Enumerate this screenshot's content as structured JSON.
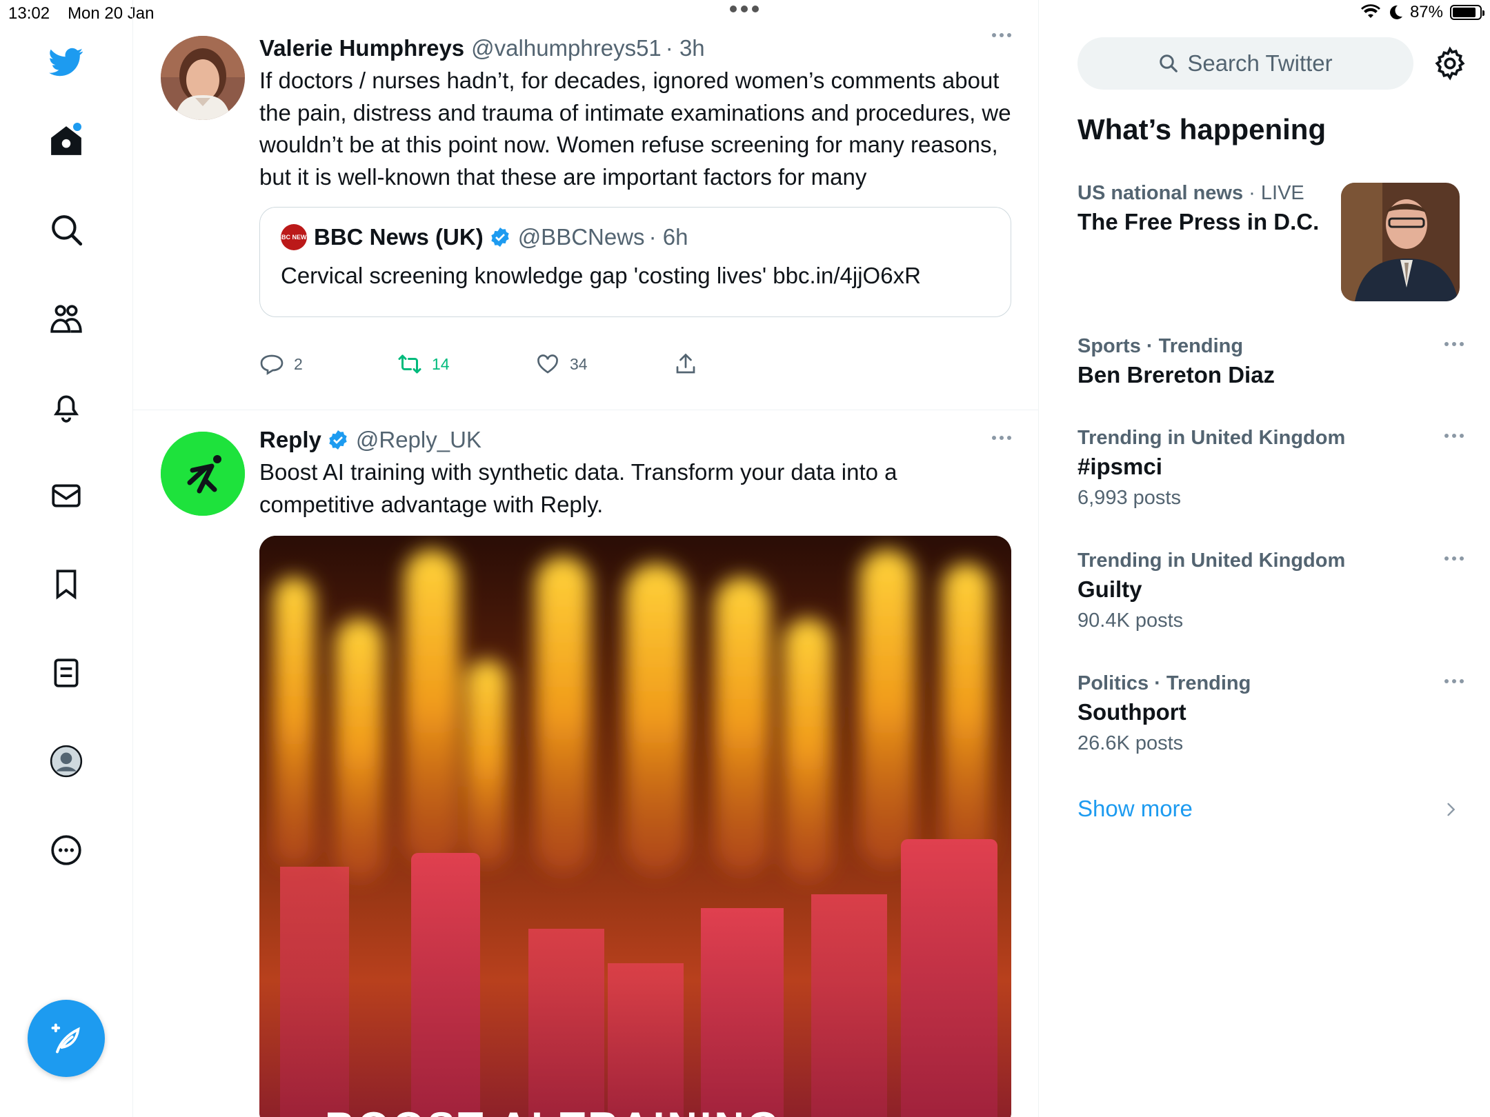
{
  "status_bar": {
    "time": "13:02",
    "date": "Mon 20 Jan",
    "battery": "87%",
    "battery_level": 0.87
  },
  "nav": {
    "items": [
      "twitter-logo",
      "home",
      "explore",
      "communities",
      "notifications",
      "messages",
      "bookmarks",
      "lists",
      "profile",
      "more"
    ],
    "compose_icon": "compose-icon"
  },
  "timeline": {
    "tweet1": {
      "name": "Valerie Humphreys",
      "handle": "@valhumphreys51",
      "time": "· 3h",
      "text": "If doctors / nurses hadn’t, for decades, ignored women’s comments about the pain, distress and trauma of intimate examinations and procedures, we wouldn’t be at this point now. Women refuse screening for many reasons, but it is well-known that these are important factors for many",
      "quote": {
        "logo_text": "BBC NEWS",
        "name": "BBC News (UK)",
        "handle": "@BBCNews",
        "time": "· 6h",
        "text": "Cervical screening knowledge gap 'costing lives' bbc.in/4jjO6xR"
      },
      "replies": "2",
      "retweets": "14",
      "likes": "34"
    },
    "tweet2": {
      "name": "Reply",
      "handle": "@Reply_UK",
      "text": "Boost AI training with synthetic data. Transform your data into a competitive advantage with Reply.",
      "media_caption": "BOOST AI TRAINING"
    }
  },
  "sidebar": {
    "search_placeholder": "Search Twitter",
    "section_title": "What’s happening",
    "news": {
      "category": "US national news",
      "live": "· LIVE",
      "title": "The Free Press in D.C."
    },
    "trends": [
      {
        "meta": "Sports · Trending",
        "title": "Ben Brereton Diaz",
        "count": ""
      },
      {
        "meta": "Trending in United Kingdom",
        "title": "#ipsmci",
        "count": "6,993 posts"
      },
      {
        "meta": "Trending in United Kingdom",
        "title": "Guilty",
        "count": "90.4K posts"
      },
      {
        "meta": "Politics · Trending",
        "title": "Southport",
        "count": "26.6K posts"
      }
    ],
    "show_more": "Show more"
  },
  "colors": {
    "accent": "#1d9bf0",
    "retweet_green": "#00ba7c",
    "text_primary": "#0f1419",
    "text_secondary": "#536471"
  }
}
